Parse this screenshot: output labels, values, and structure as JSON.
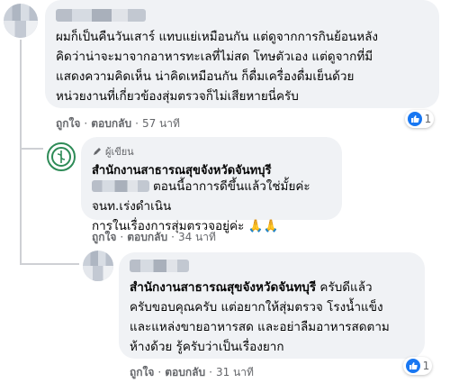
{
  "comments": [
    {
      "author_blurred": true,
      "text_lines": [
        "ผมก็เป็นคืนวันเสาร์ แทบแย่เหมือนกัน แต่ดูจากการกินย้อนหลัง",
        "คิดว่าน่าจะมาจากอาหารทะเลที่ไม่สด โทษตัวเอง แต่ดูจากที่มี",
        "แสดงความคิดเห็น น่าคิดเหมือนกัน ก็ดื่มเครื่องดื่มเย็นด้วย",
        "หน่วยงานที่เกี่ยวข้องสุ่มตรวจก็ไม่เสียหายนี่ครับ"
      ],
      "like_label": "ถูกใจ",
      "reply_label": "ตอบกลับ",
      "time": "57 นาที",
      "reaction_count": "1"
    },
    {
      "author_badge": "ผู้เขียน",
      "author": "สำนักงานสาธารณสุขจังหวัดจันทบุรี",
      "text_lines": [
        "ตอนนี้อาการดีขึ้นแล้วใช่มั้ยค่ะ จนท.เร่งดำเนิน",
        "การในเรื่องการสุ่มตรวจอยู่ค่ะ 🙏🙏"
      ],
      "like_label": "ถูกใจ",
      "reply_label": "ตอบกลับ",
      "time": "34 นาที"
    },
    {
      "author_blurred": true,
      "author": "สำนักงานสาธารณสุขจังหวัดจันทบุรี",
      "text_first": "ครับดีแล้ว",
      "text_lines": [
        "ครับขอบคุณครับ แต่อยากให้สุ่มตรวจ โรงน้ำแข็ง",
        "และแหล่งขายอาหารสด และอย่าลืมอาหารสดตาม",
        "ห้างด้วย รู้ครับว่าเป็นเรื่องยาก"
      ],
      "like_label": "ถูกใจ",
      "reply_label": "ตอบกลับ",
      "time": "31 นาที",
      "reaction_count": "1"
    }
  ],
  "separator": "·",
  "colors": {
    "bubble": "#f0f2f5",
    "like_blue": "#1877f2",
    "meta_gray": "#65676b"
  }
}
